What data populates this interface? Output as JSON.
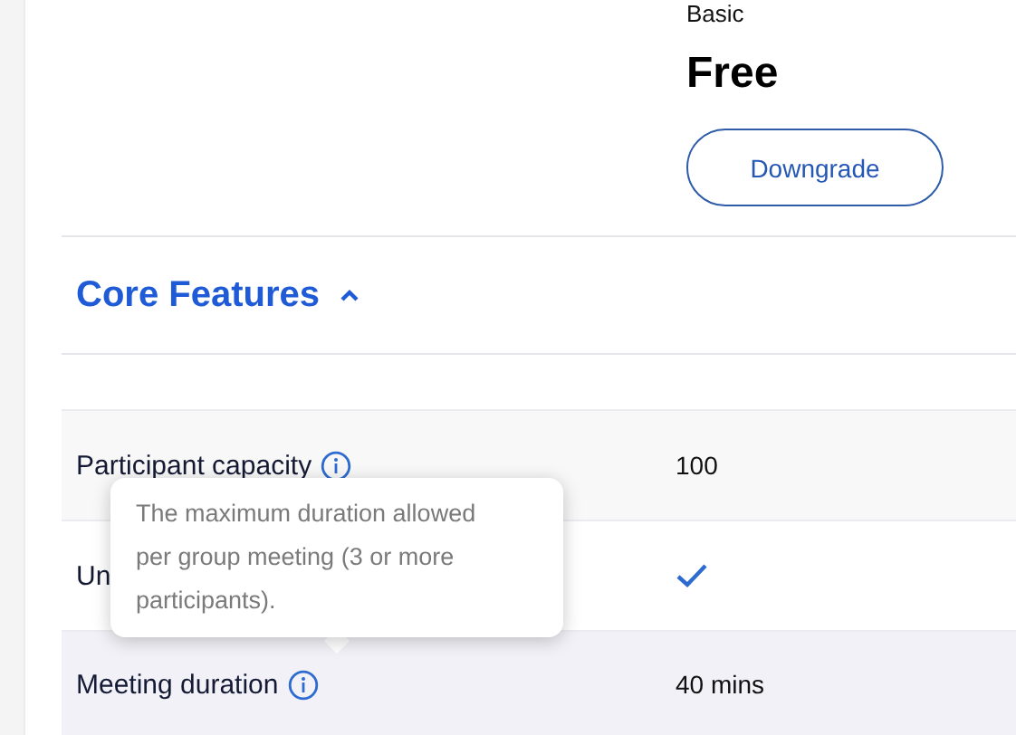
{
  "plan": {
    "name": "Basic",
    "price": "Free",
    "button": "Downgrade"
  },
  "section": {
    "title": "Core Features",
    "expanded": true
  },
  "rows": [
    {
      "label": "Participant capacity",
      "info": true,
      "kind": "text",
      "value": "100"
    },
    {
      "label": "Un",
      "info": false,
      "kind": "check",
      "checked": true
    },
    {
      "label": "Meeting duration",
      "info": true,
      "kind": "text",
      "value": "40 mins"
    }
  ],
  "tooltip": {
    "text": "The maximum duration allowed per group meeting (3 or more participants)."
  }
}
